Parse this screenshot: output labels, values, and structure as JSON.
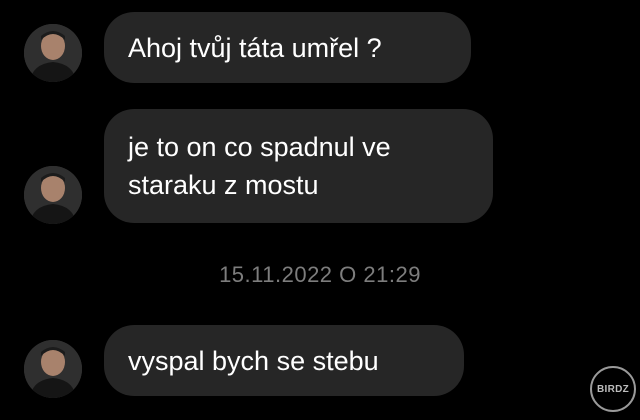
{
  "thread": {
    "messages": [
      {
        "text": "Ahoj tvůj táta umřel ?"
      },
      {
        "text": "je to on co spadnul ve staraku z mostu"
      },
      {
        "text": "vyspal bych se stebu"
      }
    ],
    "timestamp": "15.11.2022 O 21:29"
  },
  "avatar_icon": "person-avatar-icon",
  "watermark": {
    "text": "BIRDZ"
  },
  "colors": {
    "background": "#000000",
    "bubble": "#262626",
    "text": "#ffffff",
    "timestamp": "#7d7d7d"
  }
}
